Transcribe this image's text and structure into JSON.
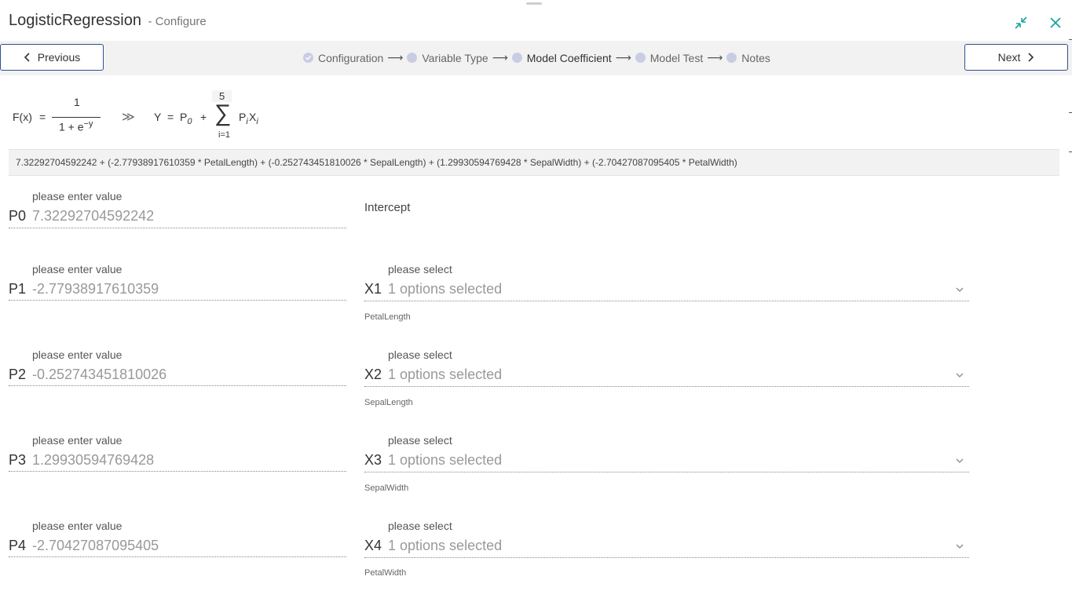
{
  "window": {
    "title": "LogisticRegression",
    "subtitle": "- Configure",
    "minimize_icon": "collapse-arrows-icon",
    "close_icon": "close-icon",
    "accent": "#1aa39a"
  },
  "nav": {
    "previous_label": "Previous",
    "next_label": "Next",
    "border_color": "#2f4f8f"
  },
  "steps": [
    {
      "label": "Configuration",
      "state": "done"
    },
    {
      "label": "Variable Type",
      "state": "pending"
    },
    {
      "label": "Model Coefficient",
      "state": "active"
    },
    {
      "label": "Model Test",
      "state": "pending"
    },
    {
      "label": "Notes",
      "state": "pending"
    }
  ],
  "formula": {
    "fx": "F(x)",
    "eq": "=",
    "numerator": "1",
    "denominator": "1 + e",
    "exponent": "−y",
    "arrows": "≫",
    "y": "Y",
    "eq2": "=",
    "p0": "P",
    "p0_sub": "0",
    "plus": "+",
    "sum_top": "5",
    "sum_sym": "∑",
    "sum_bottom": "i=1",
    "pi": "P",
    "pi_sub": "i",
    "xi": "X",
    "xi_sub": "i"
  },
  "expression": "7.32292704592242 + (-2.77938917610359 * PetalLength) + (-0.252743451810026 * SepalLength) + (1.29930594769428 * SepalWidth) + (-2.70427087095405 * PetalWidth)",
  "coefficients": {
    "value_hint": "please enter value",
    "select_hint": "please select",
    "intercept_label": "Intercept",
    "rows": [
      {
        "p": "P0",
        "value": "7.32292704592242"
      },
      {
        "p": "P1",
        "value": "-2.77938917610359",
        "x": "X1",
        "selected": "1 options selected",
        "variable": "PetalLength"
      },
      {
        "p": "P2",
        "value": "-0.252743451810026",
        "x": "X2",
        "selected": "1 options selected",
        "variable": "SepalLength"
      },
      {
        "p": "P3",
        "value": "1.29930594769428",
        "x": "X3",
        "selected": "1 options selected",
        "variable": "SepalWidth"
      },
      {
        "p": "P4",
        "value": "-2.70427087095405",
        "x": "X4",
        "selected": "1 options selected",
        "variable": "PetalWidth"
      }
    ]
  }
}
